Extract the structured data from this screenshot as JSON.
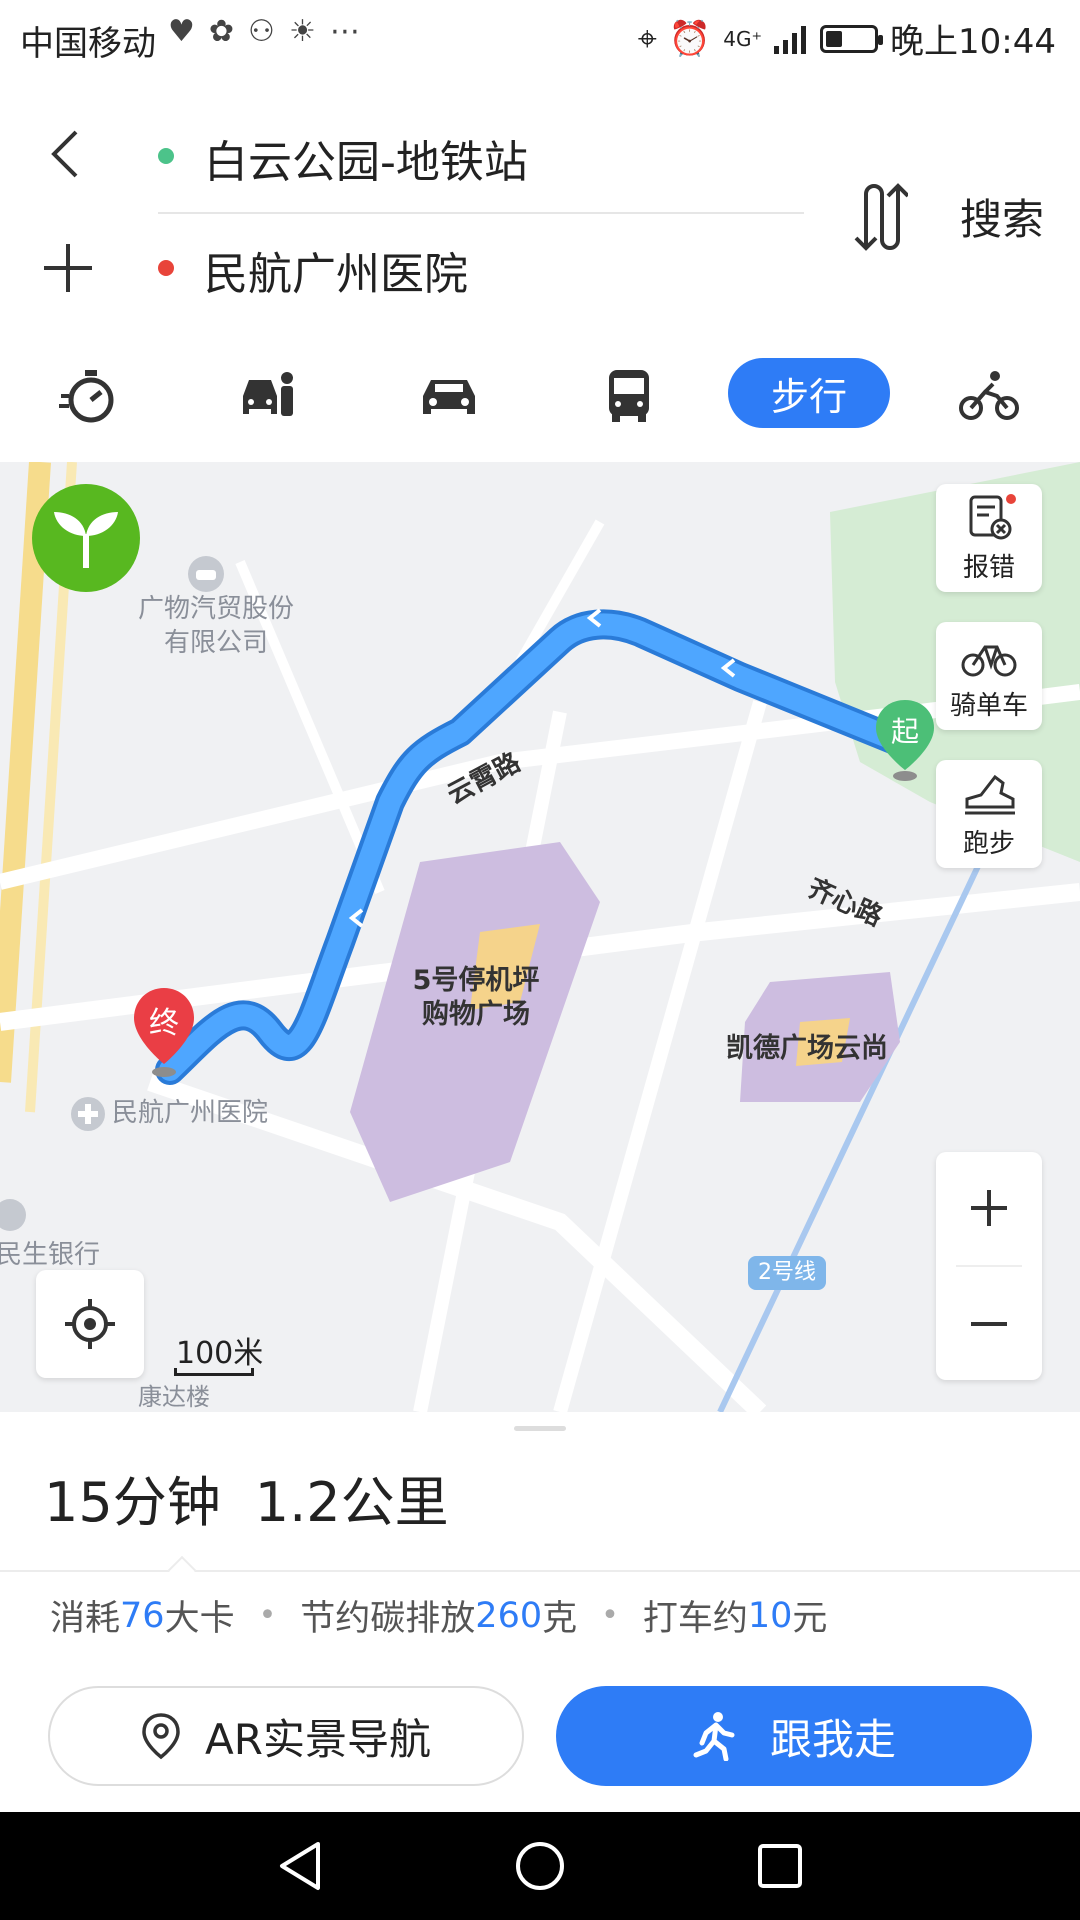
{
  "status_bar": {
    "carrier": "中国移动",
    "network": "4G⁺",
    "time": "晚上10:44",
    "battery_level": 0.35
  },
  "route": {
    "origin": "白云公园-地铁站",
    "destination": "民航广州医院",
    "search_label": "搜索"
  },
  "modes": {
    "active_label": "步行",
    "icons": [
      "stopwatch-icon",
      "carpool-icon",
      "car-icon",
      "bus-icon",
      "walk",
      "bicycle-icon"
    ]
  },
  "map": {
    "labels": {
      "company_line1": "广物汽贸股份",
      "company_line2": "有限公司",
      "road_yunxiao": "云霄路",
      "road_qixin": "齐心路",
      "parking_line1": "5号停机坪",
      "parking_line2": "购物广场",
      "kaide": "凯德广场云尚",
      "hospital": "民航广州医院",
      "bank": "民生银行",
      "kangda": "康达楼",
      "metro_line": "2号线",
      "start_marker": "起",
      "end_marker": "终"
    },
    "side_buttons": {
      "report": "报错",
      "bike": "骑单车",
      "run": "跑步"
    },
    "scale": "100米"
  },
  "summary": {
    "duration": "15分钟",
    "distance": "1.2公里"
  },
  "stats": {
    "calories_prefix": "消耗",
    "calories_value": "76",
    "calories_unit": "大卡",
    "carbon_prefix": "节约碳排放",
    "carbon_value": "260",
    "carbon_unit": "克",
    "taxi_prefix": "打车约",
    "taxi_value": "10",
    "taxi_unit": "元"
  },
  "actions": {
    "ar_nav": "AR实景导航",
    "follow_me": "跟我走"
  },
  "colors": {
    "accent": "#2e7cf6",
    "route": "#3a8ff0",
    "origin": "#4cc38a",
    "destination": "#e8443a"
  }
}
